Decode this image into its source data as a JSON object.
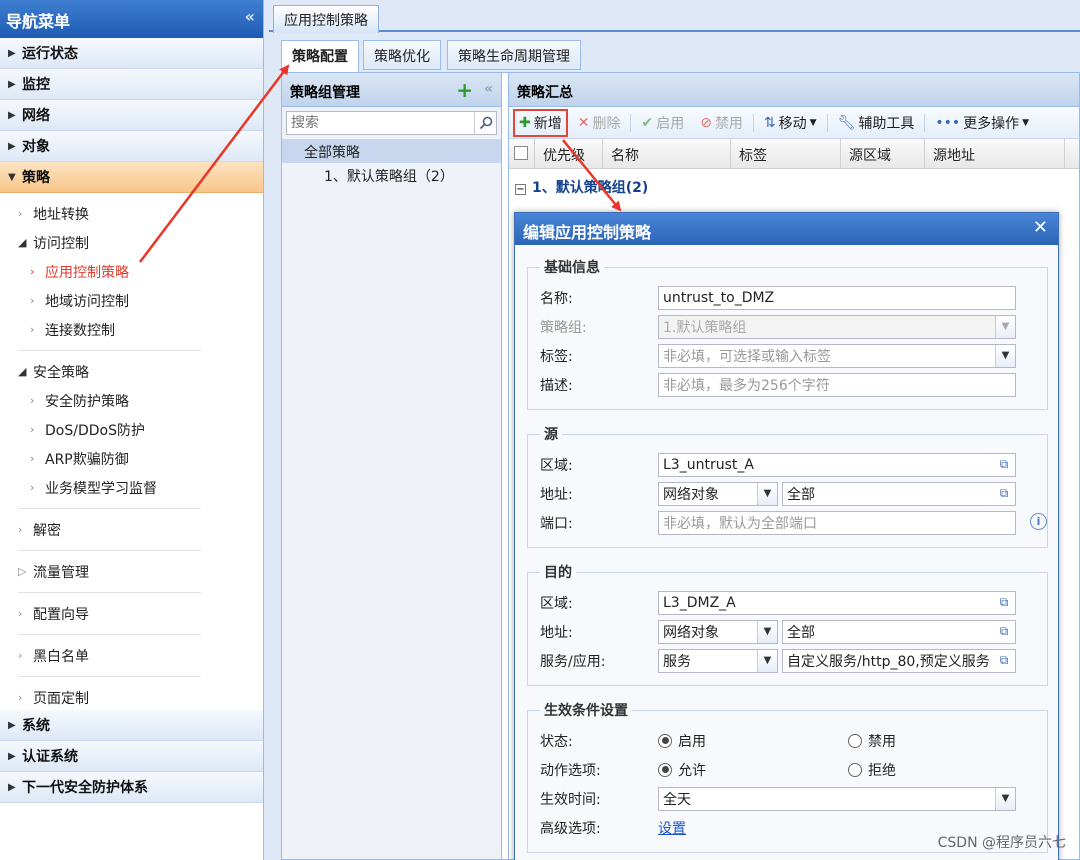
{
  "sidebar": {
    "title": "导航菜单",
    "collapse_glyph": "«",
    "top_sections": [
      "运行状态",
      "监控",
      "网络",
      "对象"
    ],
    "active_section": "策略",
    "items": {
      "nat": "地址转换",
      "access_control": "访问控制",
      "app_policy": "应用控制策略",
      "geo_access": "地域访问控制",
      "conn_limit": "连接数控制",
      "security_policy": "安全策略",
      "sec_protect": "安全防护策略",
      "ddos": "DoS/DDoS防护",
      "arp": "ARP欺骗防御",
      "biz_model": "业务模型学习监督",
      "decrypt": "解密",
      "traffic": "流量管理",
      "wizard": "配置向导",
      "blackwhite": "黑白名单",
      "page_custom": "页面定制"
    },
    "bottom_sections": [
      "系统",
      "认证系统",
      "下一代安全防护体系"
    ]
  },
  "main": {
    "tab": "应用控制策略",
    "subtabs": [
      "策略配置",
      "策略优化",
      "策略生命周期管理"
    ]
  },
  "group_panel": {
    "title": "策略组管理",
    "search_placeholder": "搜索",
    "tree": {
      "root": "全部策略",
      "child": "1、默认策略组（2）"
    }
  },
  "summary_panel": {
    "title": "策略汇总",
    "toolbar": {
      "add": "新增",
      "delete": "删除",
      "enable": "启用",
      "disable": "禁用",
      "move": "移动",
      "tools": "辅助工具",
      "more": "更多操作"
    },
    "columns": [
      "优先级",
      "名称",
      "标签",
      "源区域",
      "源地址"
    ],
    "group_row": "1、默认策略组(2)"
  },
  "dialog": {
    "title": "编辑应用控制策略",
    "basic": {
      "legend": "基础信息",
      "name_label": "名称:",
      "name_value": "untrust_to_DMZ",
      "group_label": "策略组:",
      "group_value": "1.默认策略组",
      "tag_label": "标签:",
      "tag_placeholder": "非必填，可选择或输入标签",
      "desc_label": "描述:",
      "desc_placeholder": "非必填，最多为256个字符"
    },
    "source": {
      "legend": "源",
      "zone_label": "区域:",
      "zone_value": "L3_untrust_A",
      "addr_label": "地址:",
      "addr_type": "网络对象",
      "addr_value": "全部",
      "port_label": "端口:",
      "port_placeholder": "非必填，默认为全部端口"
    },
    "dest": {
      "legend": "目的",
      "zone_label": "区域:",
      "zone_value": "L3_DMZ_A",
      "addr_label": "地址:",
      "addr_type": "网络对象",
      "addr_value": "全部",
      "svc_label": "服务/应用:",
      "svc_type": "服务",
      "svc_value": "自定义服务/http_80,预定义服务"
    },
    "effect": {
      "legend": "生效条件设置",
      "state_label": "状态:",
      "state_on": "启用",
      "state_off": "禁用",
      "action_label": "动作选项:",
      "action_allow": "允许",
      "action_deny": "拒绝",
      "time_label": "生效时间:",
      "time_value": "全天",
      "adv_label": "高级选项:",
      "adv_link": "设置"
    }
  },
  "watermark": "CSDN @程序员六七",
  "colors": {
    "arrow": "#e8362a",
    "header_blue": "#2c63b8",
    "active_orange": "#f8c688"
  }
}
